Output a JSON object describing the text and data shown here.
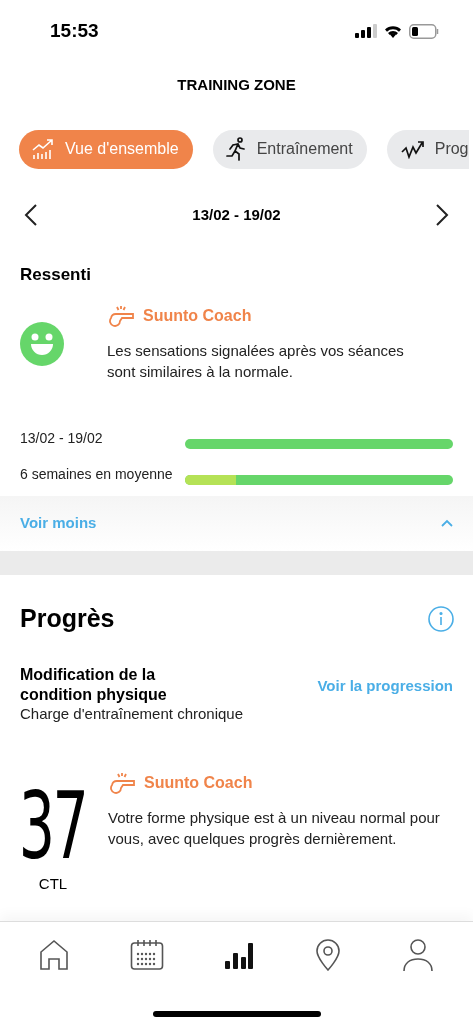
{
  "status_bar": {
    "time": "15:53"
  },
  "header": {
    "title": "TRAINING ZONE"
  },
  "tabs": [
    {
      "label": "Vue d'ensemble",
      "selected": true
    },
    {
      "label": "Entraînement",
      "selected": false
    },
    {
      "label": "Prog",
      "selected": false
    }
  ],
  "period": {
    "label": "13/02 - 19/02"
  },
  "feeling": {
    "title": "Ressenti",
    "coach": {
      "name": "Suunto Coach",
      "message": "Les sensations signalées après vos séances sont similaires à la normale."
    },
    "bars": [
      {
        "label": "13/02 - 19/02"
      },
      {
        "label": "6 semaines en moyenne",
        "level": 0.19
      }
    ],
    "toggle": {
      "label": "Voir moins",
      "expanded": true
    }
  },
  "progress": {
    "title": "Progrès",
    "metric_title": "Modification de la condition physique",
    "metric_subtitle": "Charge d'entraînement chronique",
    "link": "Voir la progression",
    "value": "37",
    "unit": "CTL",
    "coach": {
      "name": "Suunto Coach",
      "message": "Votre forme physique est à un niveau normal pour vous, avec quelques progrès dernièrement."
    }
  },
  "bottom_nav": [
    {
      "selected": false
    },
    {
      "selected": false
    },
    {
      "selected": true
    },
    {
      "selected": false
    },
    {
      "selected": false
    }
  ]
}
